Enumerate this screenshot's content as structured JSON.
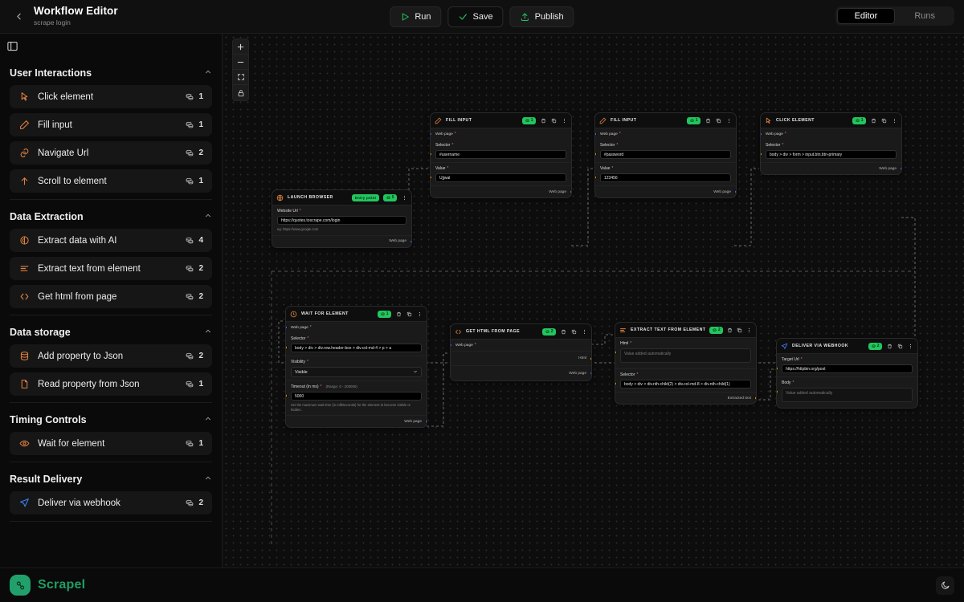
{
  "topbar": {
    "back_icon": "chevron-left-icon",
    "title": "Workflow Editor",
    "subtitle": "scrape login",
    "actions": [
      {
        "label": "Run",
        "icon": "play-icon"
      },
      {
        "label": "Save",
        "icon": "check-icon"
      },
      {
        "label": "Publish",
        "icon": "upload-icon"
      }
    ],
    "segments": [
      {
        "label": "Editor",
        "active": true
      },
      {
        "label": "Runs",
        "active": false
      }
    ]
  },
  "sidebar": {
    "panel_toggle_icon": "panel-left-icon",
    "groups": [
      {
        "title": "User Interactions",
        "collapse_icon": "chevron-up-icon",
        "items": [
          {
            "label": "Click element",
            "icon": "cursor-click-icon",
            "credits": "1"
          },
          {
            "label": "Fill input",
            "icon": "pencil-icon",
            "credits": "1"
          },
          {
            "label": "Navigate Url",
            "icon": "link-icon",
            "credits": "2"
          },
          {
            "label": "Scroll to element",
            "icon": "arrow-up-icon",
            "credits": "1"
          }
        ]
      },
      {
        "title": "Data Extraction",
        "collapse_icon": "chevron-up-icon",
        "items": [
          {
            "label": "Extract data with AI",
            "icon": "brain-icon",
            "credits": "4"
          },
          {
            "label": "Extract text from element",
            "icon": "text-lines-icon",
            "credits": "2"
          },
          {
            "label": "Get html from page",
            "icon": "code-brackets-icon",
            "credits": "2"
          }
        ]
      },
      {
        "title": "Data storage",
        "collapse_icon": "chevron-up-icon",
        "items": [
          {
            "label": "Add property to Json",
            "icon": "database-icon",
            "credits": "2"
          },
          {
            "label": "Read property from Json",
            "icon": "file-json-icon",
            "credits": "1"
          }
        ]
      },
      {
        "title": "Timing Controls",
        "collapse_icon": "chevron-up-icon",
        "items": [
          {
            "label": "Wait for element",
            "icon": "eye-icon",
            "credits": "1"
          }
        ]
      },
      {
        "title": "Result Delivery",
        "collapse_icon": "chevron-up-icon",
        "items": [
          {
            "label": "Deliver via webhook",
            "icon": "send-icon",
            "credits": "2"
          }
        ]
      }
    ]
  },
  "canvas": {
    "zoom_controls": [
      {
        "name": "zoom-in",
        "glyph": "+"
      },
      {
        "name": "zoom-out",
        "glyph": "−"
      },
      {
        "name": "fit-view",
        "glyph": "fit"
      },
      {
        "name": "lock",
        "glyph": "lock"
      }
    ],
    "node_actions": [
      "delete-icon",
      "copy-icon",
      "more-icon"
    ],
    "nodes": {
      "launch_browser": {
        "title": "Launch Browser",
        "icon": "globe-icon",
        "entry_badge": "Entry point",
        "credits": "5",
        "website_url_label": "Website Url",
        "website_url_value": "https://quotes.toscrape.com/login",
        "website_url_hint": "eg: https://www.google.com",
        "out_port": "Web page"
      },
      "fill_input_username": {
        "title": "Fill Input",
        "icon": "pencil-icon",
        "credits": "1",
        "in_port": "Web page",
        "selector_label": "Selector",
        "selector_value": "#username",
        "value_label": "Value",
        "value_value": "Ujjwal",
        "out_port": "Web page"
      },
      "fill_input_password": {
        "title": "Fill Input",
        "icon": "pencil-icon",
        "credits": "1",
        "in_port": "Web page",
        "selector_label": "Selector",
        "selector_value": "#password",
        "value_label": "Value",
        "value_value": "123456",
        "out_port": "Web page"
      },
      "click_element": {
        "title": "Click Element",
        "icon": "cursor-click-icon",
        "credits": "1",
        "in_port": "Web page",
        "selector_label": "Selector",
        "selector_value": "body > div > form > input.btn.btn-primary",
        "out_port": "Web page"
      },
      "wait_for_element": {
        "title": "Wait For Element",
        "icon": "clock-icon",
        "credits": "1",
        "in_port": "Web page",
        "selector_label": "Selector",
        "selector_value": "body > div > div.row.header-box > div.col-md-4 > p > a",
        "visibility_label": "Visibility",
        "visibility_value": "Visible",
        "timeout_label": "Timeout (in ms)",
        "timeout_range": "(Range: 0 - 200000)",
        "timeout_value": "5000",
        "timeout_help": "Set the maximum wait time (in milliseconds) for the element to become visible or hidden.",
        "out_port": "Web page"
      },
      "get_html_from_page": {
        "title": "Get Html From Page",
        "icon": "code-brackets-icon",
        "credits": "2",
        "in_port": "Web page",
        "out_port_html": "Html",
        "out_port_webpage": "Web page"
      },
      "extract_text_from_element": {
        "title": "Extract Text From Element",
        "icon": "text-lines-icon",
        "credits": "2",
        "html_label": "Html",
        "html_placeholder": "Value added automatically",
        "selector_label": "Selector",
        "selector_value": "body > div > div.nth-child(2) > div.col-md-8 > div.nth-child(1)",
        "out_port": "Extracted text"
      },
      "deliver_via_webhook": {
        "title": "Deliver Via Webhook",
        "icon": "send-icon",
        "credits": "2",
        "target_url_label": "Target Url",
        "target_url_value": "https://httpbin.org/post",
        "body_label": "Body",
        "body_placeholder": "Value added automatically"
      }
    }
  },
  "footer": {
    "brand": "Scrapel",
    "brand_icon": "scrapel-logo-icon",
    "theme_toggle_icon": "moon-icon"
  },
  "colors": {
    "accent_green": "#22c55e",
    "brand_green": "#1f9e63",
    "icon_orange": "#e08040",
    "port_blue": "#3b82f6",
    "port_amber": "#f59e0b",
    "required_red": "#f87171"
  }
}
